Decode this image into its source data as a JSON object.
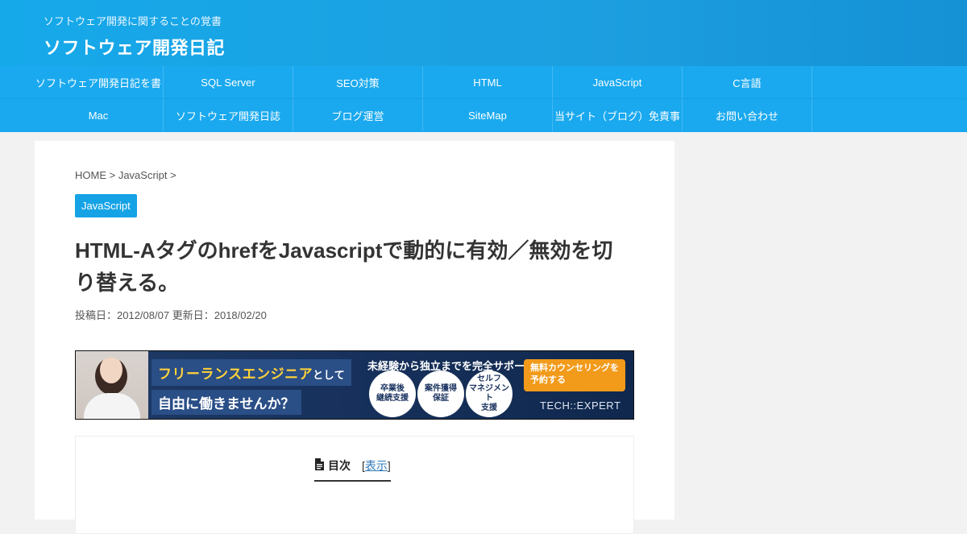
{
  "header": {
    "tagline": "ソフトウェア開発に関することの覚書",
    "site_title": "ソフトウェア開発日記"
  },
  "nav": {
    "row1": [
      "ソフトウェア開発日記を書",
      "SQL Server",
      "SEO対策",
      "HTML",
      "JavaScript",
      "C言語"
    ],
    "row2": [
      "Mac",
      "ソフトウェア開発日誌",
      "ブログ運営",
      "SiteMap",
      "当サイト（ブログ）免責事",
      "お問い合わせ"
    ]
  },
  "breadcrumb": {
    "home": "HOME",
    "sep1": " > ",
    "category": "JavaScript",
    "sep2": " >"
  },
  "category_badge": "JavaScript",
  "post": {
    "title": "HTML-AタグのhrefをJavascriptで動的に有効／無効を切り替える。",
    "posted_label": "投稿日：",
    "posted_date": "2012/08/07",
    "updated_label": "更新日：",
    "updated_date": "2018/02/20"
  },
  "ad": {
    "line1_highlight": "フリーランスエンジニア",
    "line1_suffix": "として",
    "line2": "自由に働きませんか？",
    "headline": "未経験から独立までを完全サポート",
    "circle1": "卒業後\n継続支援",
    "circle2": "案件獲得\n保証",
    "circle3": "セルフ\nマネジメント\n支援",
    "cta": "無料カウンセリングを予約する",
    "logo": "TECH::EXPERT"
  },
  "toc": {
    "title": "目次",
    "toggle_open": "[",
    "toggle_label": "表示",
    "toggle_close": "]"
  }
}
